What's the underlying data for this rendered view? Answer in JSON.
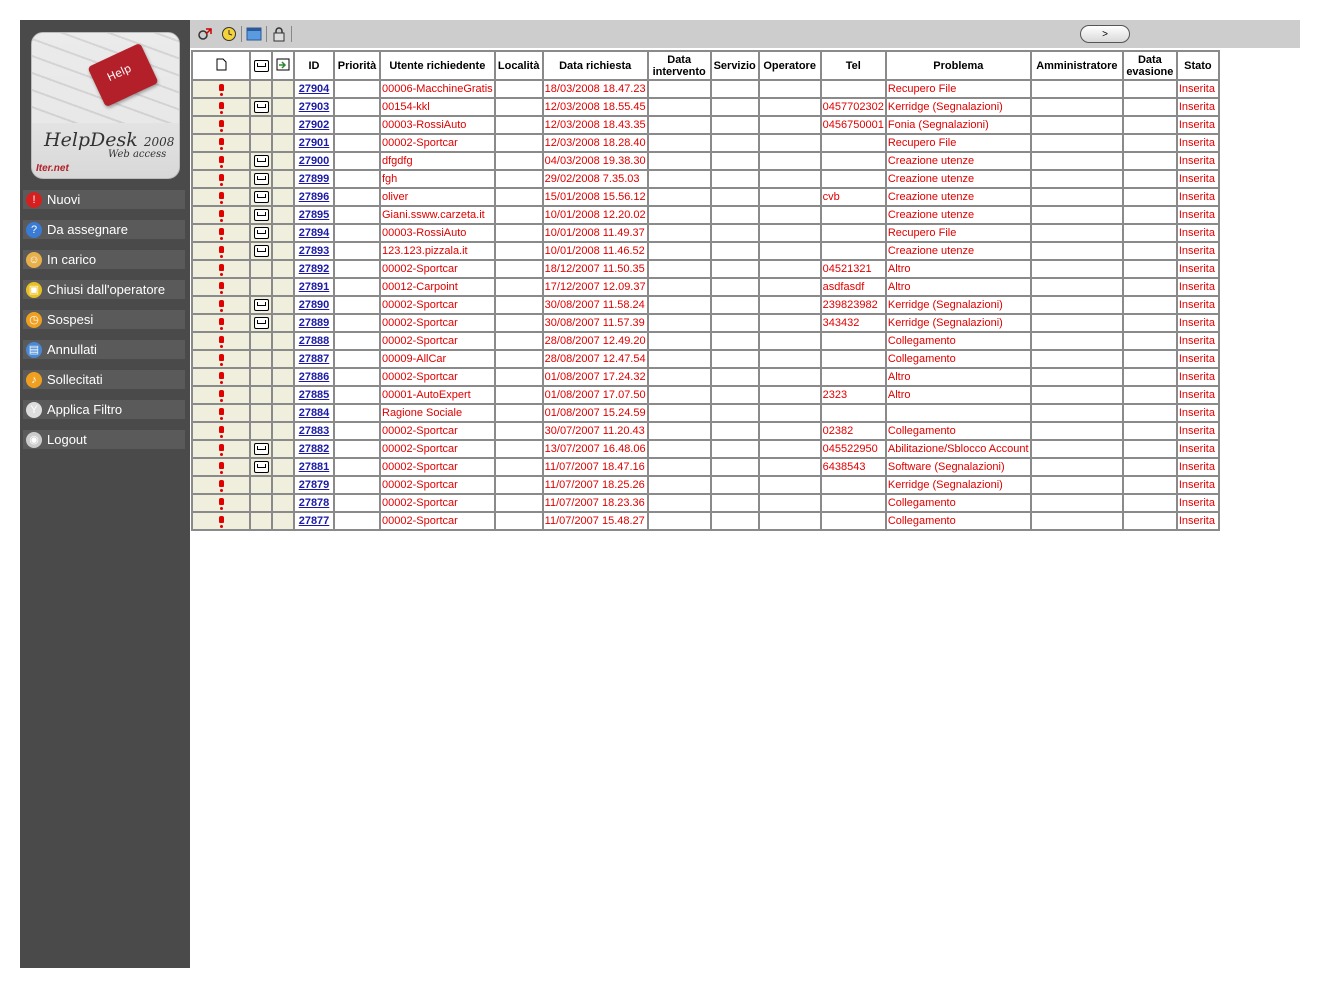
{
  "app": {
    "logo_title": "HelpDesk",
    "logo_year": "2008",
    "logo_subtitle": "Web access",
    "logo_key": "Help",
    "logo_brand": "Iter.net"
  },
  "sidebar": {
    "items": [
      {
        "label": "Nuovi",
        "icon": "warning-icon",
        "color": "#d62020"
      },
      {
        "label": "Da assegnare",
        "icon": "question-icon",
        "color": "#3a7bd5"
      },
      {
        "label": "In carico",
        "icon": "users-icon",
        "color": "#e8b04a"
      },
      {
        "label": "Chiusi dall'operatore",
        "icon": "lock-icon",
        "color": "#e8c020"
      },
      {
        "label": "Sospesi",
        "icon": "clock-icon",
        "color": "#f0a020"
      },
      {
        "label": "Annullati",
        "icon": "trash-icon",
        "color": "#4a8ad5"
      },
      {
        "label": "Sollecitati",
        "icon": "bell-icon",
        "color": "#f0a020"
      },
      {
        "label": "Applica Filtro",
        "icon": "filter-icon",
        "color": "#dddddd"
      },
      {
        "label": "Logout",
        "icon": "logout-icon",
        "color": "#cccccc"
      }
    ]
  },
  "toolbar": {
    "buttons": [
      "refresh-icon",
      "clock-icon",
      "window-icon",
      "lock-icon"
    ],
    "next_label": ">"
  },
  "table": {
    "headers": [
      "",
      "",
      "",
      "ID",
      "Priorità",
      "Utente richiedente",
      "Località",
      "Data richiesta",
      "Data intervento",
      "Servizio",
      "Operatore",
      "Tel",
      "Problema",
      "Amministratore",
      "Data evasione",
      "Stato"
    ],
    "header_icons": [
      "document-icon",
      "mail-icon",
      "attachment-icon"
    ],
    "rows": [
      {
        "mail": false,
        "id": "27904",
        "utente": "00006-MacchineGratis",
        "data": "18/03/2008 18.47.23",
        "tel": "",
        "problema": "Recupero File",
        "stato": "Inserita"
      },
      {
        "mail": true,
        "id": "27903",
        "utente": "00154-kkl",
        "data": "12/03/2008 18.55.45",
        "tel": "0457702302",
        "problema": "Kerridge (Segnalazioni)",
        "stato": "Inserita"
      },
      {
        "mail": false,
        "id": "27902",
        "utente": "00003-RossiAuto",
        "data": "12/03/2008 18.43.35",
        "tel": "0456750001",
        "problema": "Fonia (Segnalazioni)",
        "stato": "Inserita"
      },
      {
        "mail": false,
        "id": "27901",
        "utente": "00002-Sportcar",
        "data": "12/03/2008 18.28.40",
        "tel": "",
        "problema": "Recupero File",
        "stato": "Inserita"
      },
      {
        "mail": true,
        "id": "27900",
        "utente": "dfgdfg",
        "data": "04/03/2008 19.38.30",
        "tel": "",
        "problema": "Creazione utenze",
        "stato": "Inserita"
      },
      {
        "mail": true,
        "id": "27899",
        "utente": "fgh",
        "data": "29/02/2008 7.35.03",
        "tel": "",
        "problema": "Creazione utenze",
        "stato": "Inserita"
      },
      {
        "mail": true,
        "id": "27896",
        "utente": "oliver",
        "data": "15/01/2008 15.56.12",
        "tel": "cvb",
        "problema": "Creazione utenze",
        "stato": "Inserita"
      },
      {
        "mail": true,
        "id": "27895",
        "utente": "Giani.ssww.carzeta.it",
        "data": "10/01/2008 12.20.02",
        "tel": "",
        "problema": "Creazione utenze",
        "stato": "Inserita"
      },
      {
        "mail": true,
        "id": "27894",
        "utente": "00003-RossiAuto",
        "data": "10/01/2008 11.49.37",
        "tel": "",
        "problema": "Recupero File",
        "stato": "Inserita"
      },
      {
        "mail": true,
        "id": "27893",
        "utente": "123.123.pizzala.it",
        "data": "10/01/2008 11.46.52",
        "tel": "",
        "problema": "Creazione utenze",
        "stato": "Inserita"
      },
      {
        "mail": false,
        "id": "27892",
        "utente": "00002-Sportcar",
        "data": "18/12/2007 11.50.35",
        "tel": "04521321",
        "problema": "Altro",
        "stato": "Inserita"
      },
      {
        "mail": false,
        "id": "27891",
        "utente": "00012-Carpoint",
        "data": "17/12/2007 12.09.37",
        "tel": "asdfasdf",
        "problema": "Altro",
        "stato": "Inserita"
      },
      {
        "mail": true,
        "id": "27890",
        "utente": "00002-Sportcar",
        "data": "30/08/2007 11.58.24",
        "tel": "239823982",
        "problema": "Kerridge (Segnalazioni)",
        "stato": "Inserita"
      },
      {
        "mail": true,
        "id": "27889",
        "utente": "00002-Sportcar",
        "data": "30/08/2007 11.57.39",
        "tel": "343432",
        "problema": "Kerridge (Segnalazioni)",
        "stato": "Inserita"
      },
      {
        "mail": false,
        "id": "27888",
        "utente": "00002-Sportcar",
        "data": "28/08/2007 12.49.20",
        "tel": "",
        "problema": "Collegamento",
        "stato": "Inserita"
      },
      {
        "mail": false,
        "id": "27887",
        "utente": "00009-AllCar",
        "data": "28/08/2007 12.47.54",
        "tel": "",
        "problema": "Collegamento",
        "stato": "Inserita"
      },
      {
        "mail": false,
        "id": "27886",
        "utente": "00002-Sportcar",
        "data": "01/08/2007 17.24.32",
        "tel": "",
        "problema": "Altro",
        "stato": "Inserita"
      },
      {
        "mail": false,
        "id": "27885",
        "utente": "00001-AutoExpert",
        "data": "01/08/2007 17.07.50",
        "tel": "2323",
        "problema": "Altro",
        "stato": "Inserita"
      },
      {
        "mail": false,
        "id": "27884",
        "utente": "Ragione Sociale",
        "data": "01/08/2007 15.24.59",
        "tel": "",
        "problema": "",
        "stato": "Inserita"
      },
      {
        "mail": false,
        "id": "27883",
        "utente": "00002-Sportcar",
        "data": "30/07/2007 11.20.43",
        "tel": "02382",
        "problema": "Collegamento",
        "stato": "Inserita"
      },
      {
        "mail": true,
        "id": "27882",
        "utente": "00002-Sportcar",
        "data": "13/07/2007 16.48.06",
        "tel": "045522950",
        "problema": "Abilitazione/Sblocco Account",
        "stato": "Inserita"
      },
      {
        "mail": true,
        "id": "27881",
        "utente": "00002-Sportcar",
        "data": "11/07/2007 18.47.16",
        "tel": "6438543",
        "problema": "Software (Segnalazioni)",
        "stato": "Inserita"
      },
      {
        "mail": false,
        "id": "27879",
        "utente": "00002-Sportcar",
        "data": "11/07/2007 18.25.26",
        "tel": "",
        "problema": "Kerridge (Segnalazioni)",
        "stato": "Inserita"
      },
      {
        "mail": false,
        "id": "27878",
        "utente": "00002-Sportcar",
        "data": "11/07/2007 18.23.36",
        "tel": "",
        "problema": "Collegamento",
        "stato": "Inserita"
      },
      {
        "mail": false,
        "id": "27877",
        "utente": "00002-Sportcar",
        "data": "11/07/2007 15.48.27",
        "tel": "",
        "problema": "Collegamento",
        "stato": "Inserita"
      }
    ]
  }
}
